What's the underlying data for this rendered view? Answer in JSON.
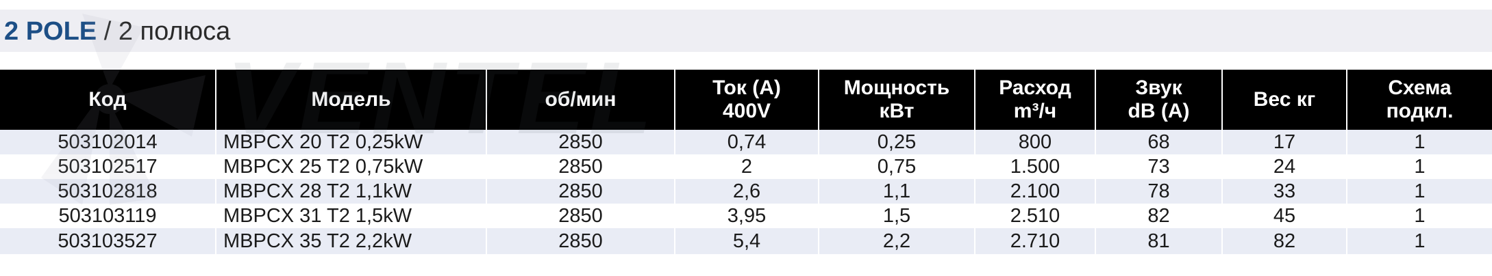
{
  "header": {
    "title_bold": "2 POLE",
    "title_separator": "/",
    "title_rest": "2 полюса"
  },
  "brand": {
    "watermark_text": "VENTEL",
    "primary_color": "#1d4f86",
    "header_bg": "#000000",
    "stripe_color": "#e9ecf5"
  },
  "table": {
    "columns": [
      {
        "key": "code",
        "lines": [
          "Код"
        ]
      },
      {
        "key": "model",
        "lines": [
          "Модель"
        ]
      },
      {
        "key": "rpm",
        "lines": [
          "об/мин"
        ]
      },
      {
        "key": "current",
        "lines": [
          "Ток (А)",
          "400V"
        ]
      },
      {
        "key": "power",
        "lines": [
          "Мощность",
          "кВт"
        ]
      },
      {
        "key": "flow",
        "lines": [
          "Расход",
          "m³/ч"
        ]
      },
      {
        "key": "sound",
        "lines": [
          "Звук",
          "dB (A)"
        ]
      },
      {
        "key": "weight",
        "lines": [
          "Вес кг"
        ]
      },
      {
        "key": "scheme",
        "lines": [
          "Схема",
          "подкл."
        ]
      }
    ],
    "rows": [
      {
        "code": "503102014",
        "model": "MBPCX 20 T2 0,25kW",
        "rpm": "2850",
        "current": "0,74",
        "power": "0,25",
        "flow": "800",
        "sound": "68",
        "weight": "17",
        "scheme": "1"
      },
      {
        "code": "503102517",
        "model": "MBPCX 25 T2 0,75kW",
        "rpm": "2850",
        "current": "2",
        "power": "0,75",
        "flow": "1.500",
        "sound": "73",
        "weight": "24",
        "scheme": "1"
      },
      {
        "code": "503102818",
        "model": "MBPCX 28 T2 1,1kW",
        "rpm": "2850",
        "current": "2,6",
        "power": "1,1",
        "flow": "2.100",
        "sound": "78",
        "weight": "33",
        "scheme": "1"
      },
      {
        "code": "503103119",
        "model": "MBPCX 31 T2 1,5kW",
        "rpm": "2850",
        "current": "3,95",
        "power": "1,5",
        "flow": "2.510",
        "sound": "82",
        "weight": "45",
        "scheme": "1"
      },
      {
        "code": "503103527",
        "model": "MBPCX 35 T2 2,2kW",
        "rpm": "2850",
        "current": "5,4",
        "power": "2,2",
        "flow": "2.710",
        "sound": "81",
        "weight": "82",
        "scheme": "1"
      }
    ]
  }
}
